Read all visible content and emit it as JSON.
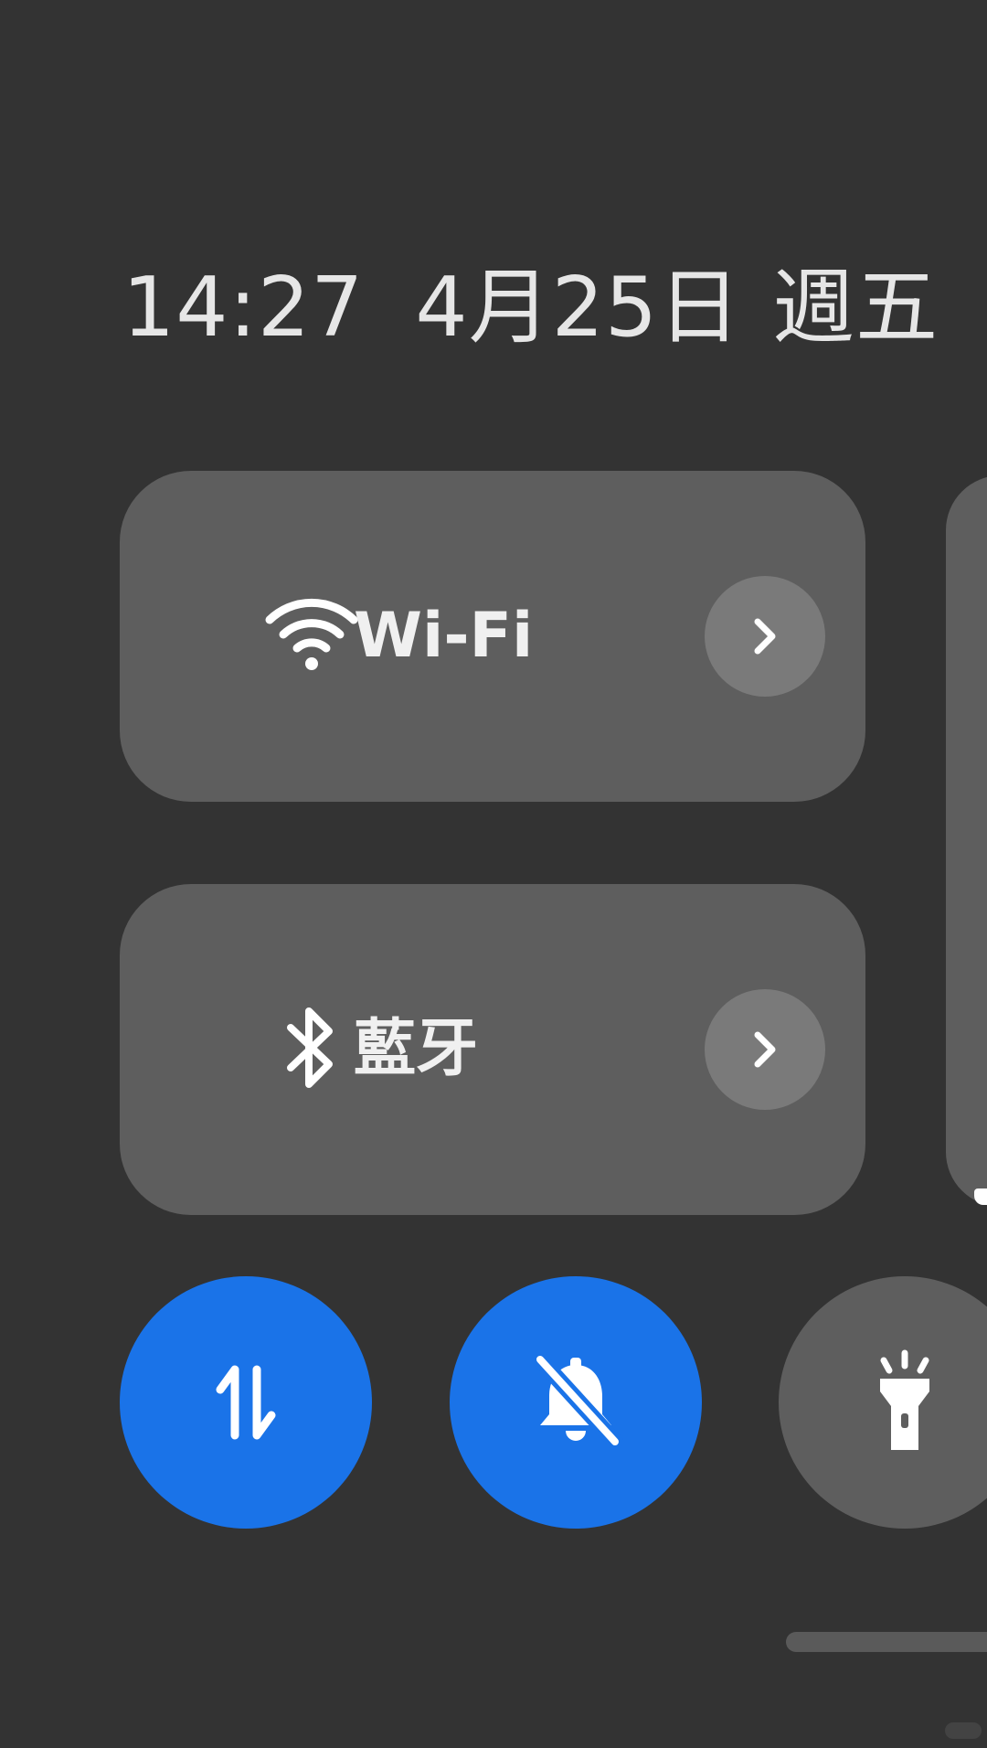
{
  "header": {
    "time": "14:27",
    "date": "4月25日",
    "weekday": "週五"
  },
  "tiles": [
    {
      "id": "wifi",
      "label": "Wi-Fi",
      "icon": "wifi-icon",
      "expand_icon": "chevron-right-icon"
    },
    {
      "id": "bluetooth",
      "label": "藍牙",
      "icon": "bluetooth-icon",
      "expand_icon": "chevron-right-icon"
    }
  ],
  "toggles": [
    {
      "id": "mobile-data",
      "icon": "data-transfer-icon",
      "active": true
    },
    {
      "id": "silent",
      "icon": "bell-off-icon",
      "active": true
    },
    {
      "id": "flashlight",
      "icon": "flashlight-icon",
      "active": false
    }
  ],
  "colors": {
    "background": "#333333",
    "tile": "#5e5e5e",
    "tile_button": "#7a7a7a",
    "accent_active": "#1a73e8",
    "inactive_toggle": "#5e5e5e",
    "text": "#e6e6e6"
  }
}
